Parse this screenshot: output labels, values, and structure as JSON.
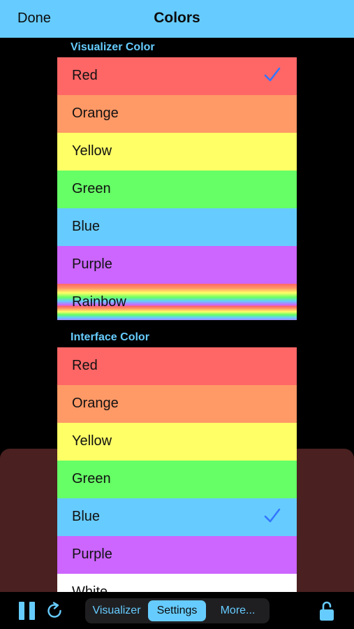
{
  "navbar": {
    "done_label": "Done",
    "title": "Colors"
  },
  "visualizer": {
    "header": "Visualizer Color",
    "items": [
      {
        "label": "Red",
        "color": "#ff6666",
        "checked": true
      },
      {
        "label": "Orange",
        "color": "#ff9966",
        "checked": false
      },
      {
        "label": "Yellow",
        "color": "#ffff66",
        "checked": false
      },
      {
        "label": "Green",
        "color": "#66ff66",
        "checked": false
      },
      {
        "label": "Blue",
        "color": "#66ccff",
        "checked": false
      },
      {
        "label": "Purple",
        "color": "#cc66ff",
        "checked": false
      },
      {
        "label": "Rainbow",
        "color": "rainbow-gradient",
        "checked": false
      }
    ]
  },
  "interface": {
    "header": "Interface Color",
    "items": [
      {
        "label": "Red",
        "color": "#ff6666",
        "checked": false
      },
      {
        "label": "Orange",
        "color": "#ff9966",
        "checked": false
      },
      {
        "label": "Yellow",
        "color": "#ffff66",
        "checked": false
      },
      {
        "label": "Green",
        "color": "#66ff66",
        "checked": false
      },
      {
        "label": "Blue",
        "color": "#66ccff",
        "checked": true
      },
      {
        "label": "Purple",
        "color": "#cc66ff",
        "checked": false
      },
      {
        "label": "White",
        "color": "#ffffff",
        "checked": false
      }
    ]
  },
  "toolbar": {
    "pause_icon": "pause-icon",
    "refresh_icon": "refresh-icon",
    "lock_icon": "lock-open-icon",
    "segments": [
      {
        "label": "Visualizer",
        "selected": false
      },
      {
        "label": "Settings",
        "selected": true
      },
      {
        "label": "More...",
        "selected": false
      }
    ]
  },
  "colors": {
    "accent": "#66ccff",
    "checkmark": "#3377ff",
    "background": "#000000",
    "panel": "#4a2020"
  }
}
